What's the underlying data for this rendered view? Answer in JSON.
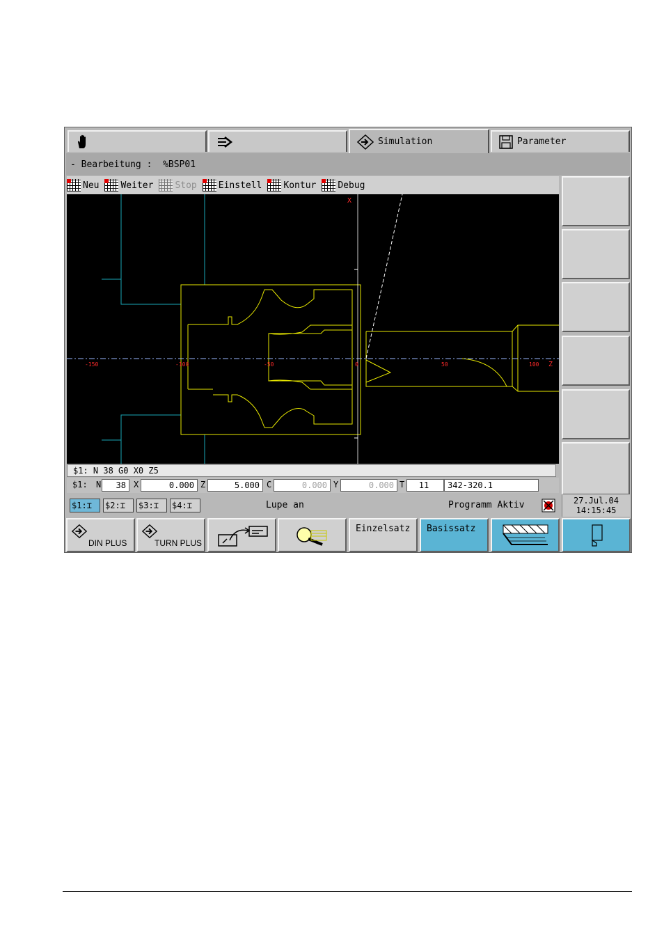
{
  "tabs": [
    {
      "label": "",
      "icon": "hand-icon"
    },
    {
      "label": "",
      "icon": "arrow-right-icon"
    },
    {
      "label": "Simulation",
      "icon": "diamond-arrow-icon",
      "active": true
    },
    {
      "label": "Parameter",
      "icon": "floppy-disk-icon"
    }
  ],
  "status": {
    "dash": "-",
    "label": "Bearbeitung :",
    "program": "%BSP01"
  },
  "menu": {
    "neu": "Neu",
    "weiter": "Weiter",
    "stop": "Stop",
    "einstell": "Einstell",
    "kontur": "Kontur",
    "debug": "Debug"
  },
  "sim_view": {
    "axis_x_label": "X",
    "axis_z_label": "Z",
    "z_ticks": [
      "-150",
      "-100",
      "-50",
      "0",
      "50",
      "100"
    ]
  },
  "nc_line": "$1: N  38 G0 X0 Z5",
  "fields": {
    "channel": "$1:",
    "n_label": "N",
    "n_value": "38",
    "x_label": "X",
    "x_value": "0.000",
    "z_label": "Z",
    "z_value": "5.000",
    "c_label": "C",
    "c_value": "0.000",
    "y_label": "Y",
    "y_value": "0.000",
    "t_label": "T",
    "t_value": "11",
    "tool_id": "342-320.1"
  },
  "channels": [
    "$1:",
    "$2:",
    "$3:",
    "$4:"
  ],
  "lupe": "Lupe an",
  "program_status": "Programm Aktiv",
  "date": "27.Jul.04",
  "time": "14:15:45",
  "bottom": {
    "din_plus": "DIN PLUS",
    "turn_plus": "TURN PLUS",
    "einzelsatz": "Einzelsatz",
    "basissatz": "Basissatz"
  }
}
